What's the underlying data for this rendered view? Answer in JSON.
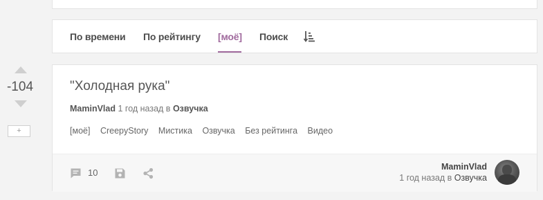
{
  "tabs": [
    {
      "label": "По времени"
    },
    {
      "label": "По рейтингу"
    },
    {
      "label": "[моё]"
    },
    {
      "label": "Поиск"
    }
  ],
  "active_tab": "[моё]",
  "sort_icon": "sort-descending-icon",
  "vote": {
    "score": "-104",
    "plus_label": "+"
  },
  "story": {
    "title": "\"Холодная рука\"",
    "author": "MaminVlad",
    "time_text": "1 год назад в",
    "community": "Озвучка",
    "tags": [
      "[моё]",
      "CreepyStory",
      "Мистика",
      "Озвучка",
      "Без рейтинга",
      "Видео"
    ]
  },
  "footer": {
    "comments_count": "10",
    "icons": [
      "comment-icon",
      "save-icon",
      "share-icon"
    ],
    "author": "MaminVlad",
    "time_text": "1 год назад в",
    "community": "Озвучка"
  },
  "colors": {
    "accent": "#a06a9d",
    "background": "#f3f3f3",
    "card": "#ffffff"
  }
}
